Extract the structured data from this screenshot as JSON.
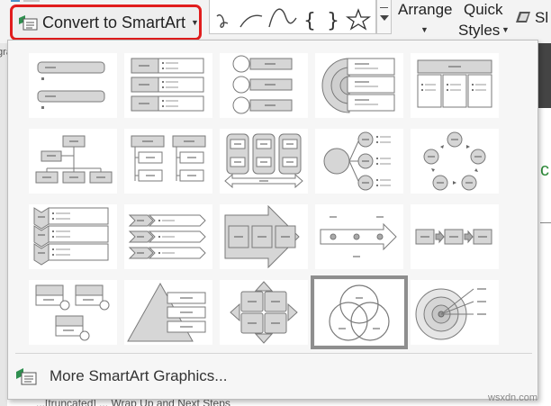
{
  "ribbon": {
    "convert_label": "Convert to SmartArt",
    "arrange_label": "Arrange",
    "quick_label": "Quick",
    "styles_label": "Styles",
    "select_label": "Sl",
    "partial_left": "a"
  },
  "backdrop": {
    "bottom_text": "...[truncated] ... Wrap Up and Next Steps",
    "right_glyph": "c",
    "left_glyph": "gra"
  },
  "gallery": {
    "more_label": "More SmartArt Graphics...",
    "tiles": [
      {
        "name": "vertical-bullet-list"
      },
      {
        "name": "vertical-box-list"
      },
      {
        "name": "vertical-circle-list"
      },
      {
        "name": "target-list"
      },
      {
        "name": "table-list"
      },
      {
        "name": "organization-chart"
      },
      {
        "name": "horizontal-hierarchy-list"
      },
      {
        "name": "vertical-tab-list"
      },
      {
        "name": "radial-list"
      },
      {
        "name": "basic-cycle"
      },
      {
        "name": "vertical-chevron-list"
      },
      {
        "name": "horizontal-chevron-list"
      },
      {
        "name": "upward-arrow"
      },
      {
        "name": "timeline-arrow"
      },
      {
        "name": "basic-process"
      },
      {
        "name": "picture-list"
      },
      {
        "name": "pyramid-list"
      },
      {
        "name": "matrix"
      },
      {
        "name": "basic-venn",
        "selected": true
      },
      {
        "name": "target"
      }
    ]
  },
  "watermark": "wsxdn.com"
}
